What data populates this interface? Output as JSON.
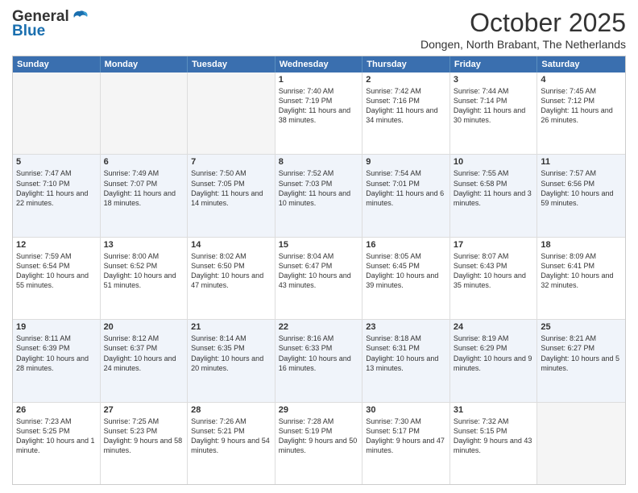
{
  "header": {
    "logo_general": "General",
    "logo_blue": "Blue",
    "month_title": "October 2025",
    "subtitle": "Dongen, North Brabant, The Netherlands"
  },
  "days_of_week": [
    "Sunday",
    "Monday",
    "Tuesday",
    "Wednesday",
    "Thursday",
    "Friday",
    "Saturday"
  ],
  "weeks": [
    [
      {
        "day": "",
        "info": ""
      },
      {
        "day": "",
        "info": ""
      },
      {
        "day": "",
        "info": ""
      },
      {
        "day": "1",
        "info": "Sunrise: 7:40 AM\nSunset: 7:19 PM\nDaylight: 11 hours\nand 38 minutes."
      },
      {
        "day": "2",
        "info": "Sunrise: 7:42 AM\nSunset: 7:16 PM\nDaylight: 11 hours\nand 34 minutes."
      },
      {
        "day": "3",
        "info": "Sunrise: 7:44 AM\nSunset: 7:14 PM\nDaylight: 11 hours\nand 30 minutes."
      },
      {
        "day": "4",
        "info": "Sunrise: 7:45 AM\nSunset: 7:12 PM\nDaylight: 11 hours\nand 26 minutes."
      }
    ],
    [
      {
        "day": "5",
        "info": "Sunrise: 7:47 AM\nSunset: 7:10 PM\nDaylight: 11 hours\nand 22 minutes."
      },
      {
        "day": "6",
        "info": "Sunrise: 7:49 AM\nSunset: 7:07 PM\nDaylight: 11 hours\nand 18 minutes."
      },
      {
        "day": "7",
        "info": "Sunrise: 7:50 AM\nSunset: 7:05 PM\nDaylight: 11 hours\nand 14 minutes."
      },
      {
        "day": "8",
        "info": "Sunrise: 7:52 AM\nSunset: 7:03 PM\nDaylight: 11 hours\nand 10 minutes."
      },
      {
        "day": "9",
        "info": "Sunrise: 7:54 AM\nSunset: 7:01 PM\nDaylight: 11 hours\nand 6 minutes."
      },
      {
        "day": "10",
        "info": "Sunrise: 7:55 AM\nSunset: 6:58 PM\nDaylight: 11 hours\nand 3 minutes."
      },
      {
        "day": "11",
        "info": "Sunrise: 7:57 AM\nSunset: 6:56 PM\nDaylight: 10 hours\nand 59 minutes."
      }
    ],
    [
      {
        "day": "12",
        "info": "Sunrise: 7:59 AM\nSunset: 6:54 PM\nDaylight: 10 hours\nand 55 minutes."
      },
      {
        "day": "13",
        "info": "Sunrise: 8:00 AM\nSunset: 6:52 PM\nDaylight: 10 hours\nand 51 minutes."
      },
      {
        "day": "14",
        "info": "Sunrise: 8:02 AM\nSunset: 6:50 PM\nDaylight: 10 hours\nand 47 minutes."
      },
      {
        "day": "15",
        "info": "Sunrise: 8:04 AM\nSunset: 6:47 PM\nDaylight: 10 hours\nand 43 minutes."
      },
      {
        "day": "16",
        "info": "Sunrise: 8:05 AM\nSunset: 6:45 PM\nDaylight: 10 hours\nand 39 minutes."
      },
      {
        "day": "17",
        "info": "Sunrise: 8:07 AM\nSunset: 6:43 PM\nDaylight: 10 hours\nand 35 minutes."
      },
      {
        "day": "18",
        "info": "Sunrise: 8:09 AM\nSunset: 6:41 PM\nDaylight: 10 hours\nand 32 minutes."
      }
    ],
    [
      {
        "day": "19",
        "info": "Sunrise: 8:11 AM\nSunset: 6:39 PM\nDaylight: 10 hours\nand 28 minutes."
      },
      {
        "day": "20",
        "info": "Sunrise: 8:12 AM\nSunset: 6:37 PM\nDaylight: 10 hours\nand 24 minutes."
      },
      {
        "day": "21",
        "info": "Sunrise: 8:14 AM\nSunset: 6:35 PM\nDaylight: 10 hours\nand 20 minutes."
      },
      {
        "day": "22",
        "info": "Sunrise: 8:16 AM\nSunset: 6:33 PM\nDaylight: 10 hours\nand 16 minutes."
      },
      {
        "day": "23",
        "info": "Sunrise: 8:18 AM\nSunset: 6:31 PM\nDaylight: 10 hours\nand 13 minutes."
      },
      {
        "day": "24",
        "info": "Sunrise: 8:19 AM\nSunset: 6:29 PM\nDaylight: 10 hours\nand 9 minutes."
      },
      {
        "day": "25",
        "info": "Sunrise: 8:21 AM\nSunset: 6:27 PM\nDaylight: 10 hours\nand 5 minutes."
      }
    ],
    [
      {
        "day": "26",
        "info": "Sunrise: 7:23 AM\nSunset: 5:25 PM\nDaylight: 10 hours\nand 1 minute."
      },
      {
        "day": "27",
        "info": "Sunrise: 7:25 AM\nSunset: 5:23 PM\nDaylight: 9 hours\nand 58 minutes."
      },
      {
        "day": "28",
        "info": "Sunrise: 7:26 AM\nSunset: 5:21 PM\nDaylight: 9 hours\nand 54 minutes."
      },
      {
        "day": "29",
        "info": "Sunrise: 7:28 AM\nSunset: 5:19 PM\nDaylight: 9 hours\nand 50 minutes."
      },
      {
        "day": "30",
        "info": "Sunrise: 7:30 AM\nSunset: 5:17 PM\nDaylight: 9 hours\nand 47 minutes."
      },
      {
        "day": "31",
        "info": "Sunrise: 7:32 AM\nSunset: 5:15 PM\nDaylight: 9 hours\nand 43 minutes."
      },
      {
        "day": "",
        "info": ""
      }
    ]
  ]
}
